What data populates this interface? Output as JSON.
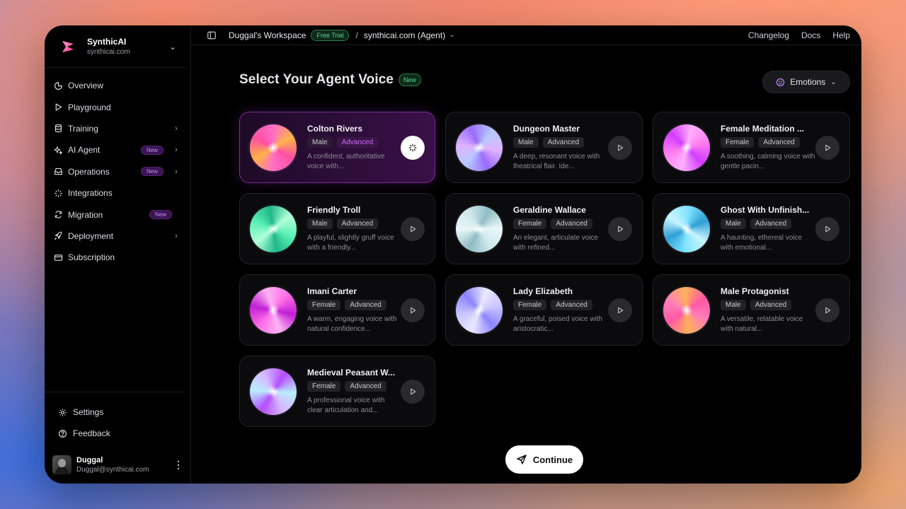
{
  "brand": {
    "name": "SynthicAI",
    "domain": "synthicai.com"
  },
  "nav": [
    {
      "label": "Overview",
      "icon": "pie-chart-icon",
      "badge": "",
      "chevron": false
    },
    {
      "label": "Playground",
      "icon": "play-icon",
      "badge": "",
      "chevron": false
    },
    {
      "label": "Training",
      "icon": "database-icon",
      "badge": "",
      "chevron": true
    },
    {
      "label": "AI Agent",
      "icon": "sparkles-icon",
      "badge": "New",
      "chevron": true
    },
    {
      "label": "Operations",
      "icon": "inbox-icon",
      "badge": "New",
      "chevron": true
    },
    {
      "label": "Integrations",
      "icon": "sparkle-star-icon",
      "badge": "",
      "chevron": false
    },
    {
      "label": "Migration",
      "icon": "refresh-icon",
      "badge": "New",
      "chevron": false
    },
    {
      "label": "Deployment",
      "icon": "rocket-icon",
      "badge": "",
      "chevron": true
    },
    {
      "label": "Subscription",
      "icon": "credit-card-icon",
      "badge": "",
      "chevron": false
    }
  ],
  "sidebar_bottom": {
    "settings": "Settings",
    "feedback": "Feedback"
  },
  "user": {
    "name": "Duggal",
    "email": "Duggal@synthicai.com"
  },
  "topbar": {
    "workspace": "Duggal's Workspace",
    "trial_badge": "Free Trial",
    "separator": "/",
    "project": "synthicai.com (Agent)",
    "links": {
      "changelog": "Changelog",
      "docs": "Docs",
      "help": "Help"
    }
  },
  "page": {
    "title": "Select Your Agent Voice",
    "title_badge": "New",
    "emotions_label": "Emotions"
  },
  "voices": [
    {
      "name": "Colton Rivers",
      "gender": "Male",
      "level": "Advanced",
      "desc": "A confident, authoritative voice with...",
      "selected": true,
      "orb": [
        "#ff6ec7",
        "#ffb347",
        "#ff4fa3"
      ]
    },
    {
      "name": "Dungeon Master",
      "gender": "Male",
      "level": "Advanced",
      "desc": "A deep, resonant voice with theatrical flair. Ide...",
      "selected": false,
      "orb": [
        "#b6c8ff",
        "#e0b3ff",
        "#9a6bff"
      ]
    },
    {
      "name": "Female Meditation ...",
      "gender": "Female",
      "level": "Advanced",
      "desc": "A soothing, calming voice with gentle pacin...",
      "selected": false,
      "orb": [
        "#ff7df0",
        "#d23cff",
        "#ffb0ff"
      ]
    },
    {
      "name": "Friendly Troll",
      "gender": "Male",
      "level": "Advanced",
      "desc": "A playful, slightly gruff voice with a friendly...",
      "selected": false,
      "orb": [
        "#5cf2b6",
        "#1fb889",
        "#b2ffd9"
      ]
    },
    {
      "name": "Geraldine Wallace",
      "gender": "Female",
      "level": "Advanced",
      "desc": "An elegant, articulate voice with refined...",
      "selected": false,
      "orb": [
        "#cfe9ec",
        "#8fbcc4",
        "#e8f7f8"
      ]
    },
    {
      "name": "Ghost With Unfinish...",
      "gender": "Male",
      "level": "Advanced",
      "desc": "A haunting, ethereal voice with emotional...",
      "selected": false,
      "orb": [
        "#7fe3ff",
        "#2f9fd6",
        "#c9f5ff"
      ]
    },
    {
      "name": "Imani Carter",
      "gender": "Female",
      "level": "Advanced",
      "desc": "A warm, engaging voice with natural confidence...",
      "selected": false,
      "orb": [
        "#ff6ee8",
        "#c21fd6",
        "#ffb3f4"
      ]
    },
    {
      "name": "Lady Elizabeth",
      "gender": "Female",
      "level": "Advanced",
      "desc": "A graceful, poised voice with aristocratic...",
      "selected": false,
      "orb": [
        "#c9c4ff",
        "#8a83ff",
        "#eae8ff"
      ]
    },
    {
      "name": "Male Protagonist",
      "gender": "Male",
      "level": "Advanced",
      "desc": "A versatile, relatable voice with natural...",
      "selected": false,
      "orb": [
        "#ff7eb8",
        "#ffb15a",
        "#ff58a6"
      ]
    },
    {
      "name": "Medieval Peasant W...",
      "gender": "Female",
      "level": "Advanced",
      "desc": "A professional voice with clear articulation and...",
      "selected": false,
      "orb": [
        "#d6b8ff",
        "#b44dff",
        "#b9ecff"
      ]
    }
  ],
  "continue_label": "Continue"
}
